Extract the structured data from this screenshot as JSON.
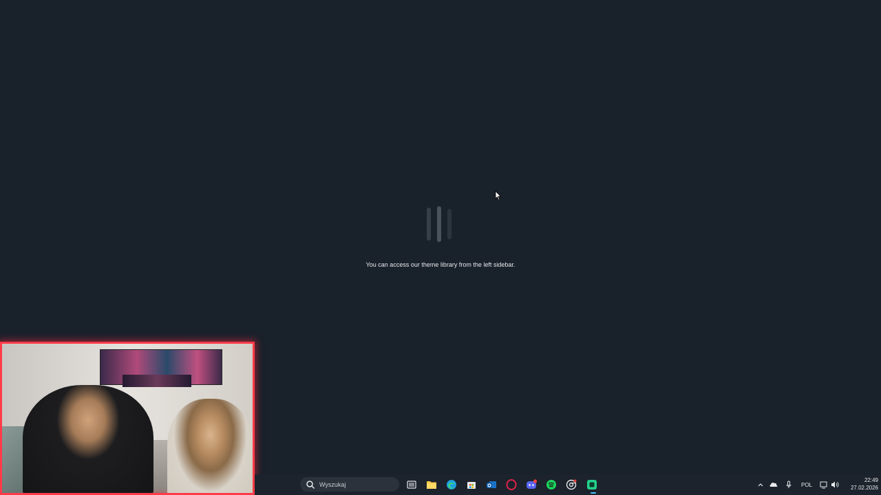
{
  "loading": {
    "message": "You can access our theme library from the left sidebar."
  },
  "taskbar": {
    "search_placeholder": "Wyszukaj",
    "language": "POL",
    "time": "22:49",
    "date": "27.02.2026",
    "pinned_apps": [
      "task-view-icon",
      "file-explorer-icon",
      "edge-icon",
      "microsoft-store-icon",
      "outlook-icon",
      "opera-icon",
      "discord-icon",
      "spotify-icon",
      "chrome-icon",
      "app-icon"
    ]
  },
  "colors": {
    "background": "#19212b",
    "taskbar": "#1c232c",
    "accent": "#4cc2ff",
    "webcam_border": "#ff3b48"
  }
}
